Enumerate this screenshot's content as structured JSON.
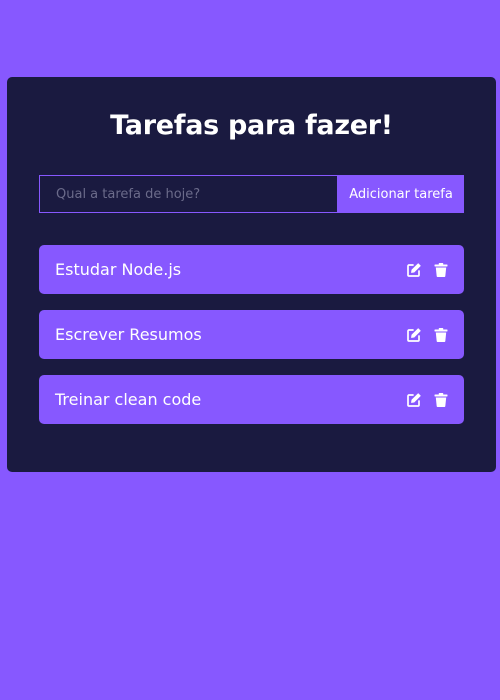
{
  "app": {
    "title": "Tarefas para fazer!"
  },
  "form": {
    "input_placeholder": "Qual a tarefa de hoje?",
    "input_value": "",
    "submit_label": "Adicionar tarefa"
  },
  "todos": [
    {
      "label": "Estudar Node.js",
      "icons": [
        "edit-icon",
        "trash-icon"
      ]
    },
    {
      "label": "Escrever Resumos",
      "icons": [
        "edit-icon",
        "trash-icon"
      ]
    },
    {
      "label": "Treinar clean code",
      "icons": [
        "edit-icon",
        "trash-icon"
      ]
    }
  ],
  "colors": {
    "background": "#8758ff",
    "card": "#1a1a40",
    "accent": "#8758ff",
    "text": "#ffffff"
  }
}
